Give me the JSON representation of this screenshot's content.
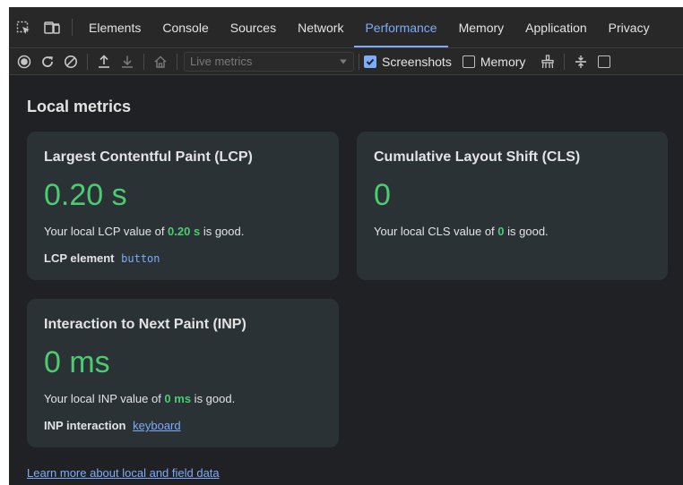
{
  "tabbar": {
    "icons": [
      "inspect-element-icon",
      "device-toolbar-icon"
    ],
    "tabs": [
      "Elements",
      "Console",
      "Sources",
      "Network",
      "Performance",
      "Memory",
      "Application",
      "Privacy"
    ],
    "active_tab": "Performance"
  },
  "toolbar": {
    "icons": [
      "record-icon",
      "reload-record-icon",
      "clear-icon",
      "upload-icon",
      "download-icon",
      "home-icon"
    ],
    "select_value": "Live metrics",
    "screenshots_label": "Screenshots",
    "screenshots_checked": true,
    "memory_label": "Memory",
    "memory_checked": false,
    "more_checked": false
  },
  "main": {
    "heading": "Local metrics",
    "lcp": {
      "title": "Largest Contentful Paint (LCP)",
      "value": "0.20 s",
      "desc_prefix": "Your local LCP value of ",
      "desc_value": "0.20 s",
      "desc_suffix": " is good.",
      "extra_label": "LCP element",
      "extra_value": "button"
    },
    "cls": {
      "title": "Cumulative Layout Shift (CLS)",
      "value": "0",
      "desc_prefix": "Your local CLS value of ",
      "desc_value": "0",
      "desc_suffix": " is good."
    },
    "inp": {
      "title": "Interaction to Next Paint (INP)",
      "value": "0 ms",
      "desc_prefix": "Your local INP value of ",
      "desc_value": "0 ms",
      "desc_suffix": " is good.",
      "extra_label": "INP interaction",
      "extra_value": "keyboard"
    },
    "learn_more": "Learn more about local and field data"
  },
  "colors": {
    "background": "#202124",
    "card": "#2b3236",
    "good": "#4ccb71",
    "accent": "#7cacf8"
  }
}
